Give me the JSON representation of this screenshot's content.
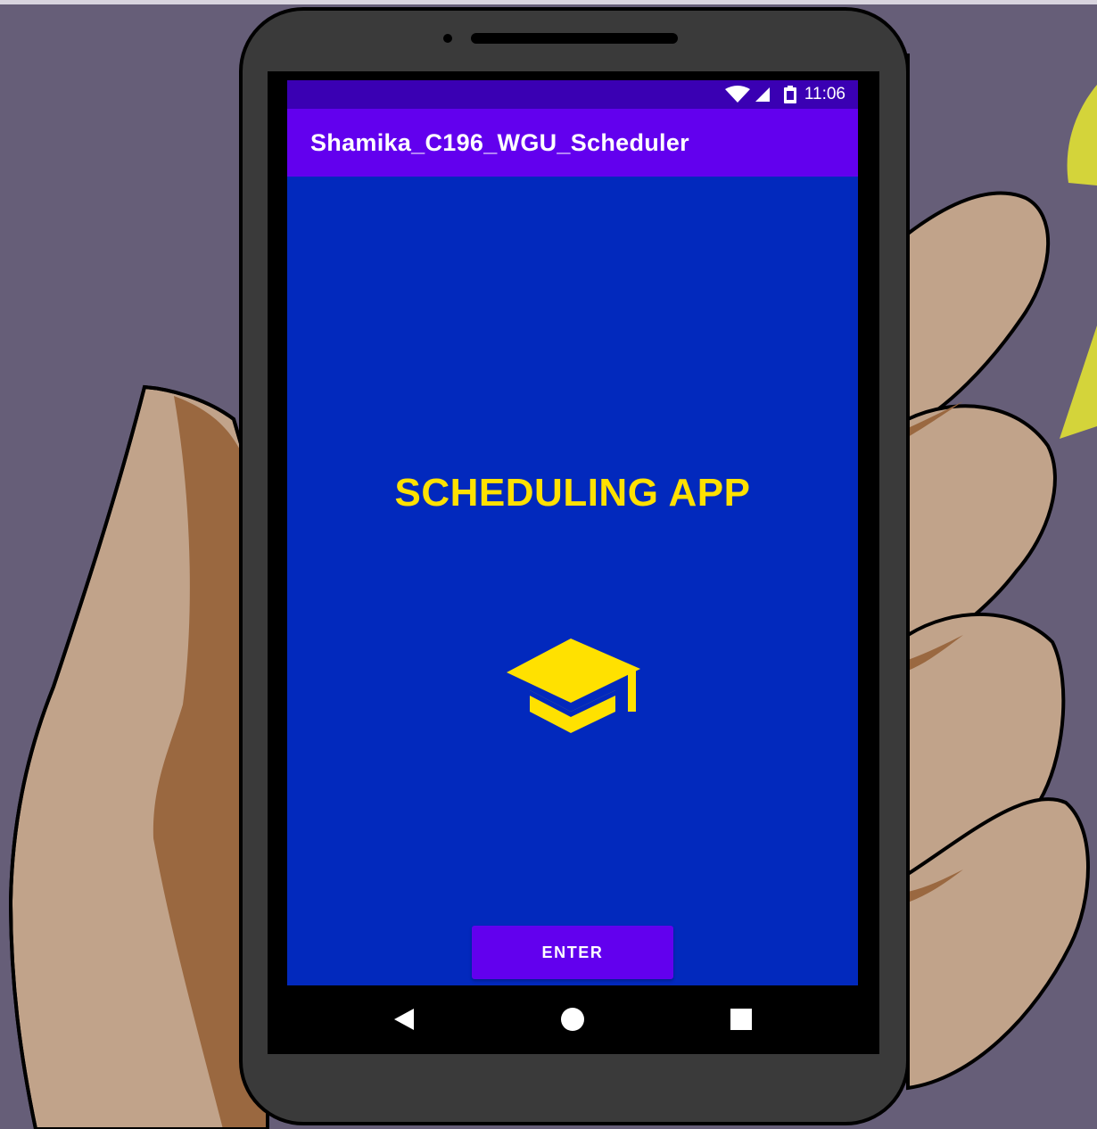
{
  "status_bar": {
    "time": "11:06",
    "icons": [
      "wifi-icon",
      "signal-icon",
      "battery-icon"
    ]
  },
  "app_bar": {
    "title": "Shamika_C196_WGU_Scheduler"
  },
  "main": {
    "heading": "SCHEDULING APP",
    "icon": "graduation-cap-icon",
    "enter_label": "ENTER"
  },
  "nav_bar": {
    "buttons": [
      "back-icon",
      "home-icon",
      "recents-icon"
    ]
  },
  "colors": {
    "background": "#665e78",
    "phone_body": "#3a3a3a",
    "status_bar": "#3a00b3",
    "app_bar": "#6200ee",
    "content": "#0229bd",
    "accent_yellow": "#ffe100",
    "button": "#6200ee",
    "skin_light": "#c1a38a",
    "skin_dark": "#9a6840"
  }
}
